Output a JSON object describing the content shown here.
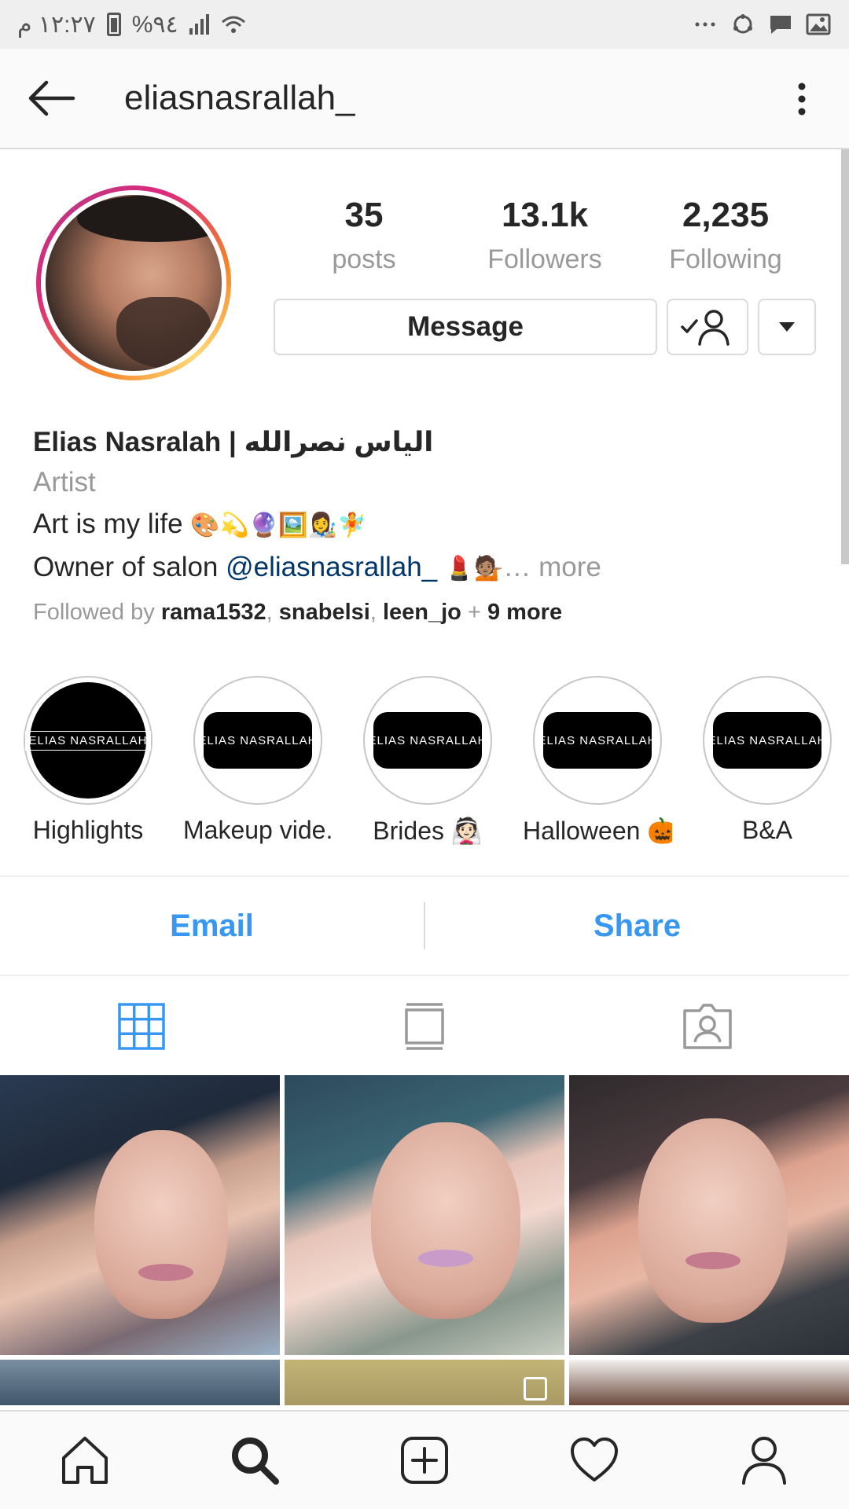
{
  "status_bar": {
    "time": "١٢:٢٧ م",
    "battery": "%٩٤"
  },
  "header": {
    "username": "eliasnasrallah_"
  },
  "profile": {
    "stats": [
      {
        "value": "35",
        "label": "posts"
      },
      {
        "value": "13.1k",
        "label": "Followers"
      },
      {
        "value": "2,235",
        "label": "Following"
      }
    ],
    "message_button": "Message"
  },
  "bio": {
    "name": "Elias Nasralah | الياس نصرالله",
    "category": "Artist",
    "line1_text": "Art is my life ",
    "line1_emoji": "🎨💫🔮🖼️👩‍🎨🧚",
    "line2_prefix": "Owner of salon ",
    "line2_mention": "@eliasnasrallah_",
    "line2_emoji": " 💄💁🏽",
    "line2_more": "… more",
    "followed_prefix": "Followed by ",
    "followed_users": [
      "rama1532",
      "snabelsi",
      "leen_jo"
    ],
    "followed_more": "9 more"
  },
  "highlights": [
    {
      "label": "Highlights",
      "logo": "ELIAS NASRALLAH"
    },
    {
      "label": "Makeup vide...",
      "logo": "ELIAS NASRALLAH"
    },
    {
      "label": "Brides 👰🏻",
      "logo": "ELIAS NASRALLAH"
    },
    {
      "label": "Halloween 🎃",
      "logo": "ELIAS NASRALLAH"
    },
    {
      "label": "B&A",
      "logo": "ELIAS NASRALLAH"
    }
  ],
  "actions": {
    "email": "Email",
    "share": "Share"
  },
  "colors": {
    "accent": "#3897f0",
    "mention": "#003569",
    "muted": "#999999",
    "text": "#262626"
  },
  "icons": {
    "back": "back-arrow-icon",
    "more": "vertical-dots-icon",
    "grid": "grid-icon",
    "feed": "feed-icon",
    "tagged": "tagged-icon",
    "home": "home-icon",
    "search": "search-icon",
    "add": "add-post-icon",
    "activity": "heart-icon",
    "profile": "profile-icon"
  }
}
